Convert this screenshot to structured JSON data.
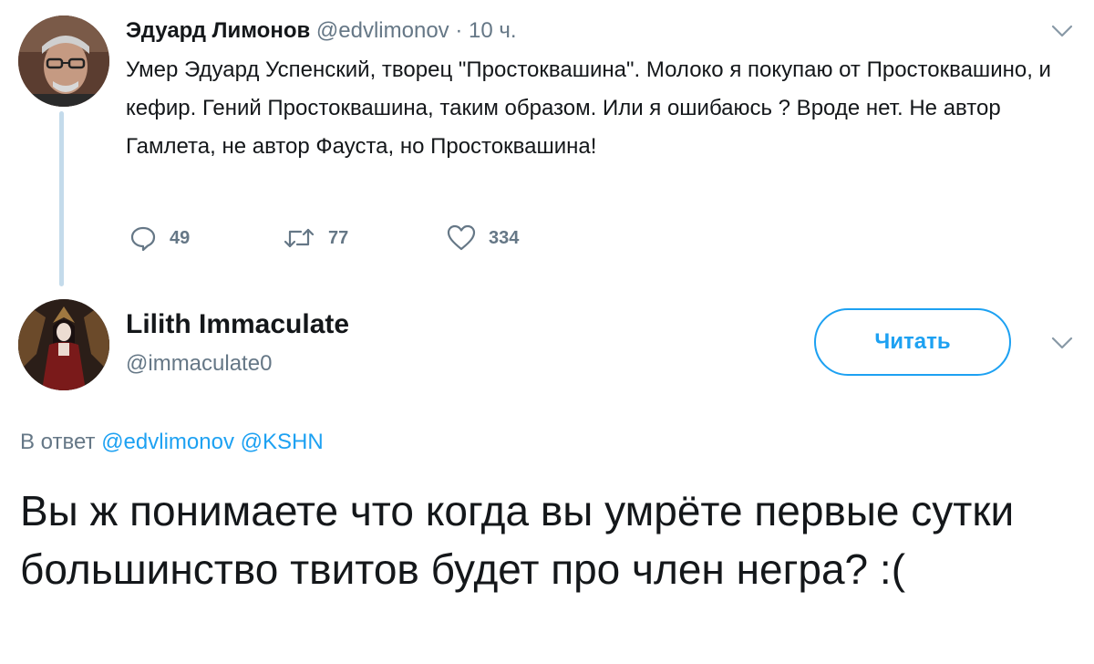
{
  "parent_tweet": {
    "author_name": "Эдуард Лимонов",
    "author_handle": "@edvlimonov",
    "separator": "·",
    "time": "10 ч.",
    "text": "Умер Эдуард Успенский, творец \"Простоквашина\". Молоко я покупаю от Простоквашино, и кефир. Гений Простоквашина, таким образом. Или я ошибаюсь ? Вроде нет. Не автор Гамлета, не автор Фауста, но Простоквашина!",
    "replies_count": "49",
    "retweets_count": "77",
    "likes_count": "334",
    "avatar_icon": "portrait-avatar-icon",
    "more_icon": "chevron-down-icon"
  },
  "reply_tweet": {
    "author_name": "Lilith Immaculate",
    "author_handle": "@immaculate0",
    "follow_label": "Читать",
    "more_icon": "chevron-down-icon",
    "avatar_icon": "portrait-avatar-icon",
    "reply_to_prefix": "В ответ",
    "reply_to_mentions": "@edvlimonov @KSHN",
    "text": "Вы ж понимаете что когда вы умрёте первые сутки большинство твитов будет про член негра? :("
  },
  "colors": {
    "accent": "#1da1f2",
    "text": "#14171a",
    "secondary": "#657786",
    "thread_line": "#c4dbeb"
  }
}
